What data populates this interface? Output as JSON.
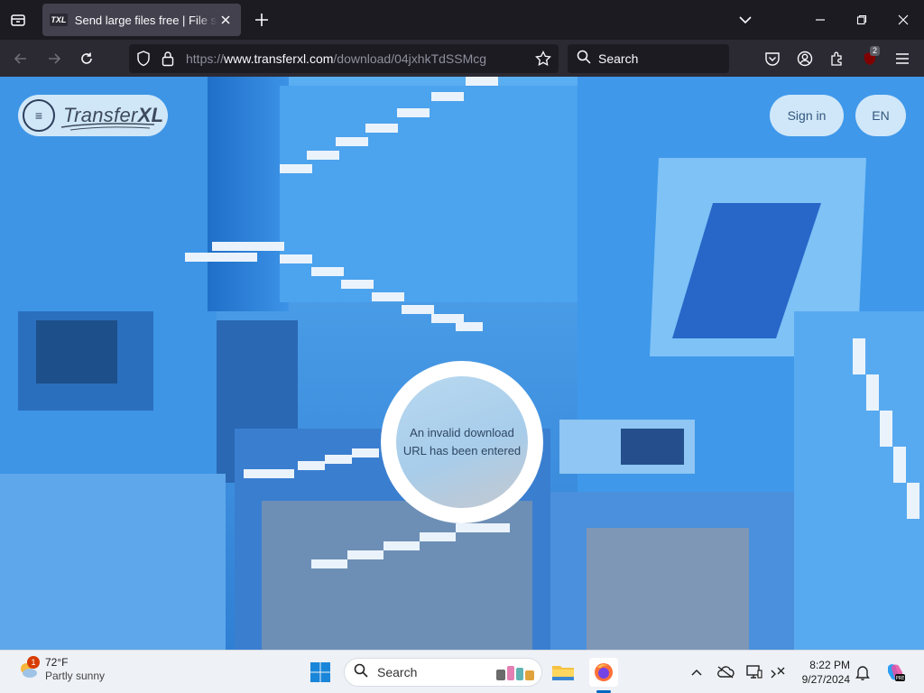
{
  "browser": {
    "tab": {
      "favicon_text": "TXL",
      "title": "Send large files free | File sharing"
    },
    "url": {
      "scheme": "https://",
      "host": "www.transferxl.com",
      "path": "/download/04jxhkTdSSMcg"
    },
    "search_label": "Search",
    "extension_badge": "2"
  },
  "page": {
    "logo": {
      "word1": "Transfer",
      "word2": "XL"
    },
    "menu_glyph": "≡",
    "signin_label": "Sign in",
    "language_label": "EN",
    "message": {
      "line1": "An invalid download",
      "line2": "URL has been entered"
    }
  },
  "taskbar": {
    "weather": {
      "temp": "72°F",
      "condition": "Partly sunny",
      "badge": "1"
    },
    "search_label": "Search",
    "time": "8:22 PM",
    "date": "9/27/2024"
  },
  "colors": {
    "accent": "#0067c0",
    "sky_blue": "#3a8fe0",
    "browser_dark": "#1c1b22"
  }
}
